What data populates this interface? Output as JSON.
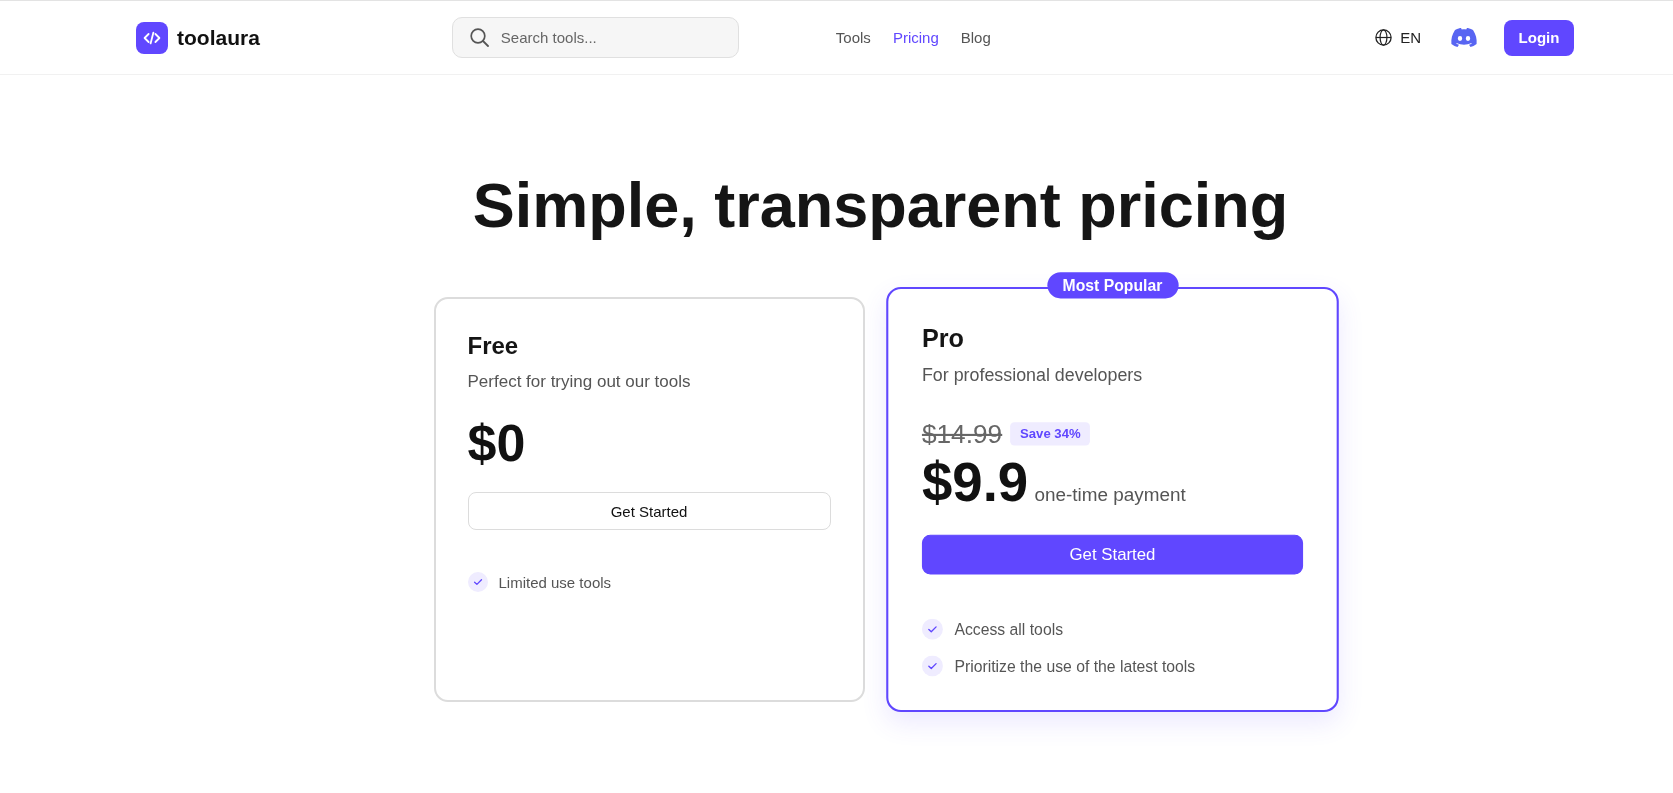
{
  "header": {
    "logo": {
      "name": "toolaura"
    },
    "search": {
      "placeholder": "Search tools..."
    },
    "nav": [
      {
        "label": "Tools",
        "selected": false
      },
      {
        "label": "Pricing",
        "selected": true
      },
      {
        "label": "Blog",
        "selected": false
      }
    ],
    "language": "EN",
    "login": "Login"
  },
  "heading": "Simple, transparent pricing",
  "plans": [
    {
      "name": "Free",
      "description": "Perfect for trying out our tools",
      "price": "$0",
      "button": "Get Started",
      "highlighted": false,
      "features": [
        "Limited use tools"
      ]
    },
    {
      "badge": "Most Popular",
      "name": "Pro",
      "description": "For professional developers",
      "old_price": "$14.99",
      "discount": "Save 34%",
      "price": "$9.9",
      "price_note": "one-time payment",
      "button": "Get Started",
      "highlighted": true,
      "features": [
        "Access all tools",
        "Prioritize the use of the latest tools"
      ]
    }
  ]
}
